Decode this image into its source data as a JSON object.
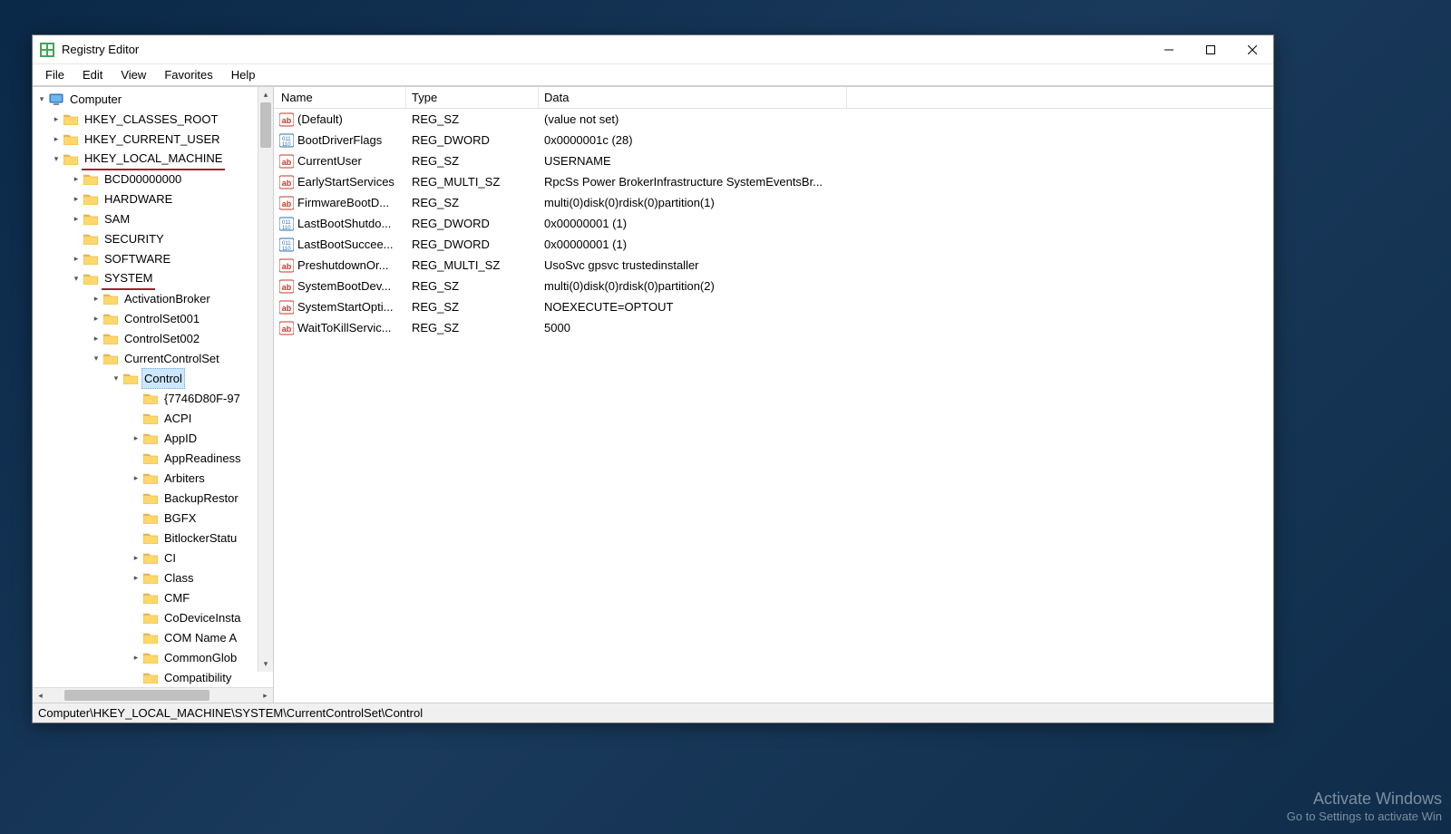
{
  "window": {
    "title": "Registry Editor"
  },
  "menubar": [
    "File",
    "Edit",
    "View",
    "Favorites",
    "Help"
  ],
  "tree": {
    "root": "Computer",
    "hklm_underline": true,
    "system_underline": true,
    "control_underline": true,
    "nodes": {
      "hkcr": "HKEY_CLASSES_ROOT",
      "hkcu": "HKEY_CURRENT_USER",
      "hklm": "HKEY_LOCAL_MACHINE",
      "bcd": "BCD00000000",
      "hardware": "HARDWARE",
      "sam": "SAM",
      "security": "SECURITY",
      "software": "SOFTWARE",
      "system": "SYSTEM",
      "activationbroker": "ActivationBroker",
      "cs001": "ControlSet001",
      "cs002": "ControlSet002",
      "ccs": "CurrentControlSet",
      "control": "Control",
      "guid": "{7746D80F-97",
      "acpi": "ACPI",
      "appid": "AppID",
      "appreadiness": "AppReadiness",
      "arbiters": "Arbiters",
      "backuprestore": "BackupRestor",
      "bgfx": "BGFX",
      "bitlocker": "BitlockerStatu",
      "ci": "CI",
      "class": "Class",
      "cmf": "CMF",
      "codevice": "CoDeviceInsta",
      "comname": "COM Name A",
      "commonglob": "CommonGlob",
      "compat": "Compatibility"
    }
  },
  "list": {
    "columns": {
      "name": "Name",
      "type": "Type",
      "data": "Data"
    },
    "rows": [
      {
        "name": "(Default)",
        "type": "REG_SZ",
        "data": "(value not set)",
        "kind": "sz"
      },
      {
        "name": "BootDriverFlags",
        "type": "REG_DWORD",
        "data": "0x0000001c (28)",
        "kind": "dw"
      },
      {
        "name": "CurrentUser",
        "type": "REG_SZ",
        "data": "USERNAME",
        "kind": "sz"
      },
      {
        "name": "EarlyStartServices",
        "type": "REG_MULTI_SZ",
        "data": "RpcSs Power BrokerInfrastructure SystemEventsBr...",
        "kind": "sz"
      },
      {
        "name": "FirmwareBootD...",
        "type": "REG_SZ",
        "data": "multi(0)disk(0)rdisk(0)partition(1)",
        "kind": "sz"
      },
      {
        "name": "LastBootShutdo...",
        "type": "REG_DWORD",
        "data": "0x00000001 (1)",
        "kind": "dw"
      },
      {
        "name": "LastBootSuccee...",
        "type": "REG_DWORD",
        "data": "0x00000001 (1)",
        "kind": "dw"
      },
      {
        "name": "PreshutdownOr...",
        "type": "REG_MULTI_SZ",
        "data": "UsoSvc gpsvc trustedinstaller",
        "kind": "sz"
      },
      {
        "name": "SystemBootDev...",
        "type": "REG_SZ",
        "data": "multi(0)disk(0)rdisk(0)partition(2)",
        "kind": "sz"
      },
      {
        "name": "SystemStartOpti...",
        "type": "REG_SZ",
        "data": " NOEXECUTE=OPTOUT",
        "kind": "sz"
      },
      {
        "name": "WaitToKillServic...",
        "type": "REG_SZ",
        "data": "5000",
        "kind": "sz"
      }
    ]
  },
  "statusbar": {
    "path": "Computer\\HKEY_LOCAL_MACHINE\\SYSTEM\\CurrentControlSet\\Control"
  },
  "watermark": {
    "title": "Activate Windows",
    "sub": "Go to Settings to activate Win"
  }
}
